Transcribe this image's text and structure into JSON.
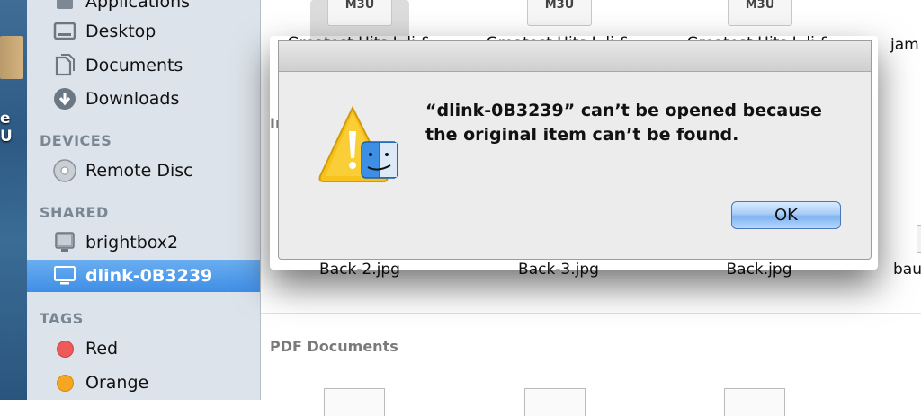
{
  "desktop": {
    "label": "e U"
  },
  "sidebar": {
    "favorites": [
      {
        "label": "Applications",
        "icon": "applications-icon"
      },
      {
        "label": "Desktop",
        "icon": "desktop-icon"
      },
      {
        "label": "Documents",
        "icon": "documents-icon"
      },
      {
        "label": "Downloads",
        "icon": "downloads-icon"
      }
    ],
    "devices_header": "DEVICES",
    "devices": [
      {
        "label": "Remote Disc",
        "icon": "disc-icon"
      }
    ],
    "shared_header": "SHARED",
    "shared": [
      {
        "label": "brightbox2",
        "icon": "server-icon"
      },
      {
        "label": "dlink-0B3239",
        "icon": "monitor-icon",
        "selected": true
      }
    ],
    "tags_header": "TAGS",
    "tags": [
      {
        "label": "Red",
        "color": "#ee5a5a"
      },
      {
        "label": "Orange",
        "color": "#f5a623"
      }
    ]
  },
  "content": {
    "top_files": [
      {
        "badge": "M3U",
        "name": "Greatest Hits I..li &"
      },
      {
        "badge": "M3U",
        "name": "Greatest Hits I..li &"
      },
      {
        "badge": "M3U",
        "name": "Greatest Hits I..li &"
      },
      {
        "badge": "",
        "name": "jam"
      }
    ],
    "images_section_partial": "Im",
    "image_files": [
      {
        "name": "Back-2.jpg"
      },
      {
        "name": "Back-3.jpg"
      },
      {
        "name": "Back.jpg"
      },
      {
        "name": "bau"
      }
    ],
    "pdf_section": "PDF Documents"
  },
  "dialog": {
    "message_line1": "“dlink-0B3239” can’t be opened because",
    "message_line2": "the original item can’t be found.",
    "ok_label": "OK",
    "icon": "warning-finder-icon"
  }
}
